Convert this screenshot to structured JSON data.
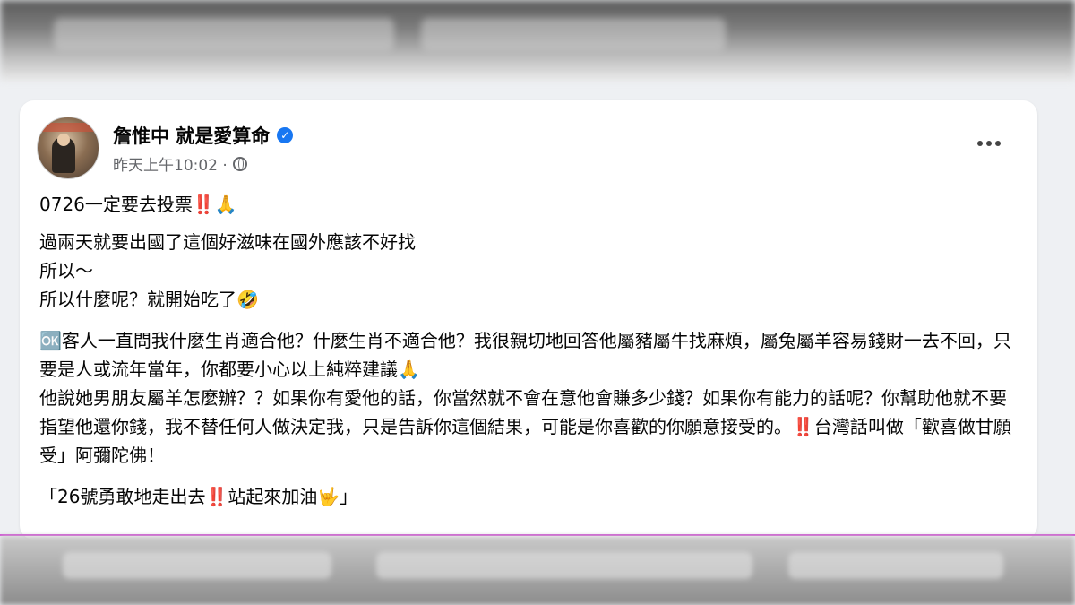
{
  "post": {
    "author": "詹惟中 就是愛算命",
    "timestamp": "昨天上午10:02 ·",
    "paragraphs": [
      "0726一定要去投票‼️🙏",
      "過兩天就要出國了這個好滋味在國外應該不好找\n所以～\n所以什麼呢？就開始吃了🤣",
      "🆗客人一直問我什麼生肖適合他？什麼生肖不適合他？我很親切地回答他屬豬屬牛找麻煩，屬兔屬羊容易錢財一去不回，只要是人或流年當年，你都要小心以上純粹建議🙏\n他說她男朋友屬羊怎麼辦？？如果你有愛他的話，你當然就不會在意他會賺多少錢？如果你有能力的話呢？你幫助他就不要指望他還你錢，我不替任何人做決定我，只是告訴你這個結果，可能是你喜歡的你願意接受的。‼️台灣話叫做「歡喜做甘願受」阿彌陀佛！",
      "「26號勇敢地走出去‼️站起來加油🤟」"
    ]
  },
  "icons": {
    "verified": "verified-badge-icon",
    "privacy": "globe-icon",
    "more": "more-options-icon"
  },
  "colors": {
    "verified": "#1877f2",
    "secondary_text": "#65676b",
    "accent_line": "#d24ad6"
  }
}
